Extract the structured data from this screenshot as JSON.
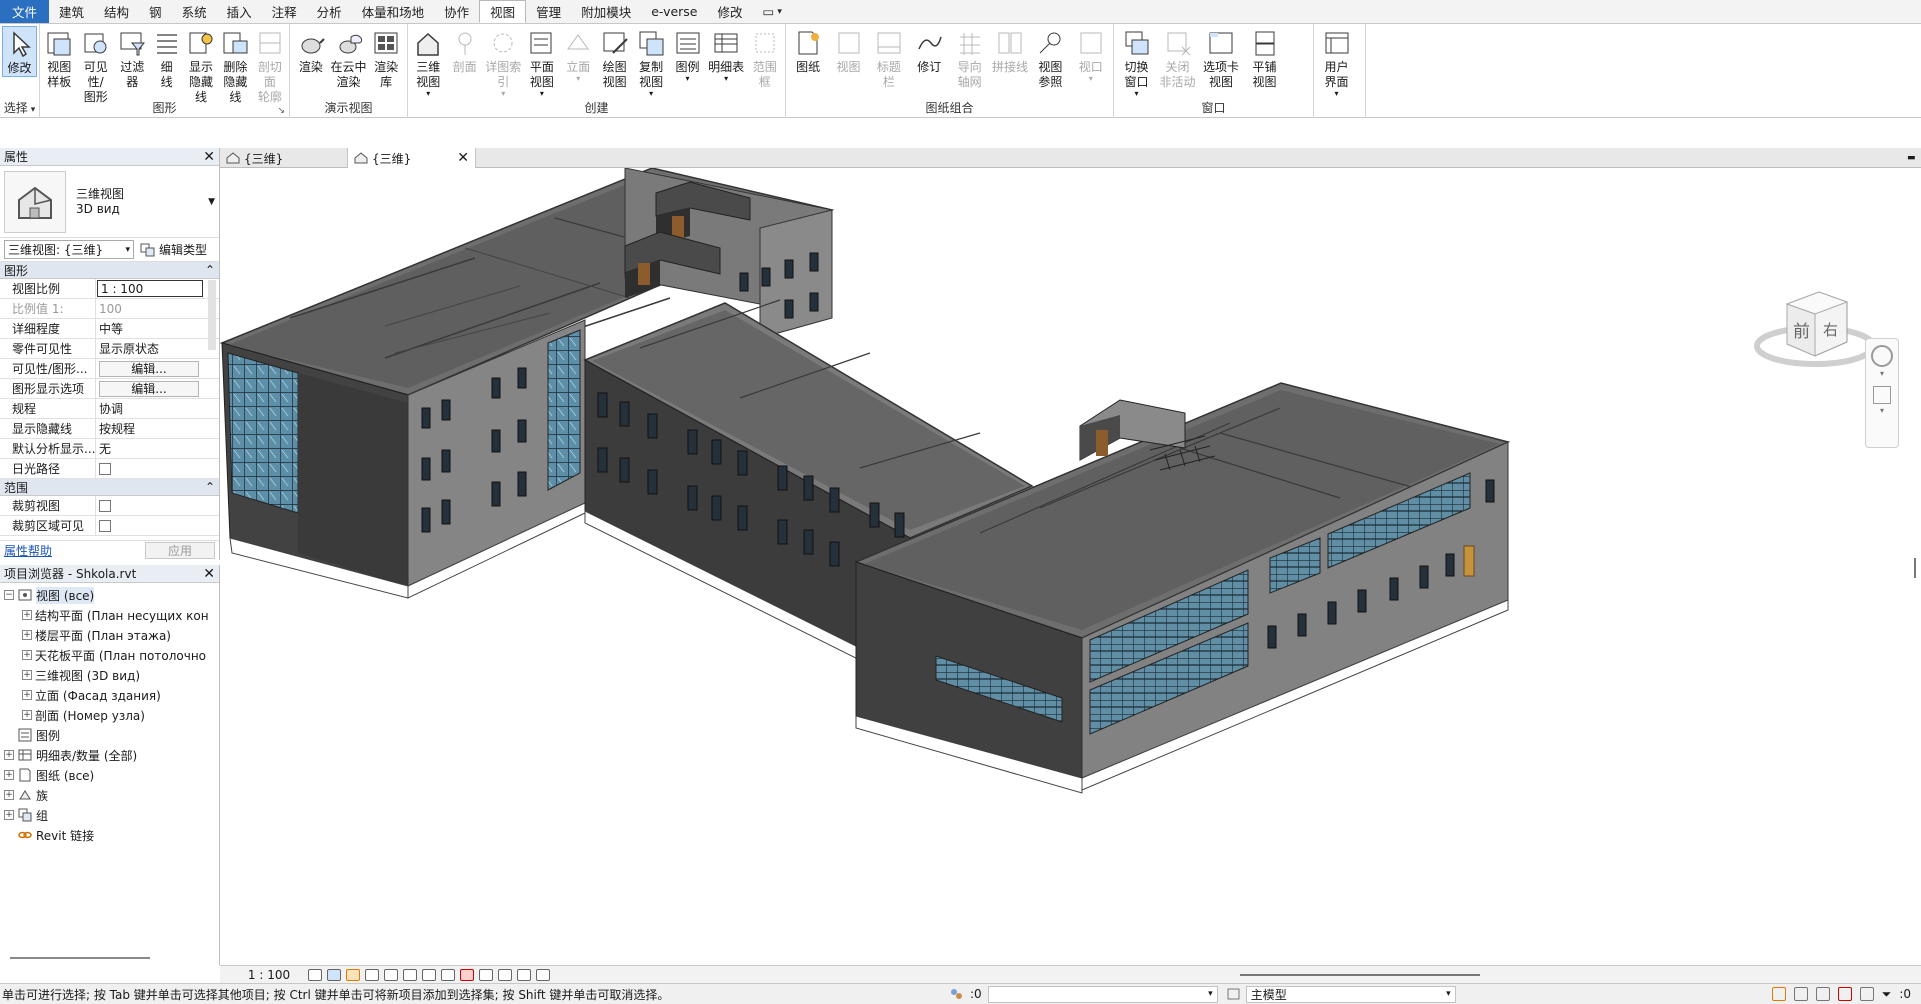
{
  "tabs": [
    {
      "label": "文件",
      "kind": "file"
    },
    {
      "label": "建筑"
    },
    {
      "label": "结构"
    },
    {
      "label": "钢"
    },
    {
      "label": "系统"
    },
    {
      "label": "插入"
    },
    {
      "label": "注释"
    },
    {
      "label": "分析"
    },
    {
      "label": "体量和场地"
    },
    {
      "label": "协作"
    },
    {
      "label": "视图",
      "active": true
    },
    {
      "label": "管理"
    },
    {
      "label": "附加模块"
    },
    {
      "label": "e-verse"
    },
    {
      "label": "修改"
    },
    {
      "label": "▭",
      "caret": "▾"
    }
  ],
  "panels": [
    {
      "title": "选择",
      "title_caret": "▾",
      "width": 40,
      "buttons": [
        {
          "label": "修改",
          "icon": "cursor-arrow-icon",
          "selected": true
        }
      ]
    },
    {
      "title": "图形",
      "dialog": "↘",
      "width": 250,
      "buttons": [
        {
          "label": "视图\n样板",
          "icon": "view-template-icon"
        },
        {
          "label": "可见性/\n图形",
          "icon": "visibility-graphics-icon",
          "wide": true
        },
        {
          "label": "过滤器",
          "icon": "filter-icon"
        },
        {
          "label": "细\n线",
          "icon": "thin-lines-icon"
        },
        {
          "label": "显示\n隐藏线",
          "icon": "show-hidden-lines-icon"
        },
        {
          "label": "删除\n隐藏线",
          "icon": "remove-hidden-lines-icon"
        },
        {
          "label": "剖切面\n轮廓",
          "icon": "cut-profile-icon",
          "disabled": true
        }
      ]
    },
    {
      "title": "演示视图",
      "width": 118,
      "buttons": [
        {
          "label": "渲染",
          "icon": "render-teapot-icon"
        },
        {
          "label": "在云中\n渲染",
          "icon": "render-cloud-icon"
        },
        {
          "label": "渲染\n库",
          "icon": "render-gallery-icon"
        }
      ]
    },
    {
      "title": "创建",
      "width": 378,
      "buttons": [
        {
          "label": "三维\n视图",
          "icon": "3d-house-icon",
          "caret": true
        },
        {
          "label": "剖面",
          "icon": "section-icon",
          "disabled": true
        },
        {
          "label": "详图索引",
          "icon": "callout-icon",
          "disabled": true,
          "caret": true,
          "wide": true
        },
        {
          "label": "平面\n视图",
          "icon": "plan-views-icon",
          "caret": true
        },
        {
          "label": "立面",
          "icon": "elevation-icon",
          "disabled": true,
          "caret": true
        },
        {
          "label": "绘图\n视图",
          "icon": "drafting-view-icon"
        },
        {
          "label": "复制\n视图",
          "icon": "duplicate-view-icon",
          "caret": true
        },
        {
          "label": "图例",
          "icon": "legend-icon",
          "caret": true
        },
        {
          "label": "明细表",
          "icon": "schedule-icon",
          "caret": true,
          "wide": true
        },
        {
          "label": "范围\n框",
          "icon": "scope-box-icon",
          "disabled": true
        }
      ]
    },
    {
      "title": "图纸组合",
      "width": 328,
      "buttons": [
        {
          "label": "图纸",
          "icon": "sheet-icon"
        },
        {
          "label": "视图",
          "icon": "place-view-icon",
          "disabled": true
        },
        {
          "label": "标题\n栏",
          "icon": "title-block-icon",
          "disabled": true
        },
        {
          "label": "修订",
          "icon": "revision-icon"
        },
        {
          "label": "导向\n轴网",
          "icon": "guide-grid-icon",
          "disabled": true
        },
        {
          "label": "拼接线",
          "icon": "matchline-icon",
          "disabled": true
        },
        {
          "label": "视图\n参照",
          "icon": "view-reference-icon"
        },
        {
          "label": "视口",
          "icon": "viewport-icon",
          "disabled": true,
          "caret": true
        }
      ]
    },
    {
      "title": "窗口",
      "width": 200,
      "buttons": [
        {
          "label": "切换\n窗口",
          "icon": "switch-windows-icon",
          "caret": true
        },
        {
          "label": "关闭\n非活动",
          "icon": "close-inactive-icon",
          "disabled": true
        },
        {
          "label": "选项卡\n视图",
          "icon": "tab-views-icon",
          "wide": true
        },
        {
          "label": "平铺\n视图",
          "icon": "tile-views-icon"
        }
      ]
    },
    {
      "title": "",
      "width": 52,
      "buttons": [
        {
          "label": "用户\n界面",
          "icon": "user-interface-icon",
          "caret": true
        }
      ]
    }
  ],
  "properties": {
    "title": "属性",
    "type_name": "三维视图",
    "type_sub": "3D вид",
    "instance_selector": "三维视图: {三维}",
    "edit_type": "编辑类型",
    "sections": [
      {
        "title": "图形",
        "rows": [
          {
            "k": "视图比例",
            "v": "1 : 100",
            "box": true
          },
          {
            "k": "比例值 1:",
            "v": "100",
            "disabled": true
          },
          {
            "k": "详细程度",
            "v": "中等"
          },
          {
            "k": "零件可见性",
            "v": "显示原状态"
          },
          {
            "k": "可见性/图形...",
            "v": "编辑...",
            "button": true
          },
          {
            "k": "图形显示选项",
            "v": "编辑...",
            "button": true
          },
          {
            "k": "规程",
            "v": "协调"
          },
          {
            "k": "显示隐藏线",
            "v": "按规程"
          },
          {
            "k": "默认分析显示...",
            "v": "无"
          },
          {
            "k": "日光路径",
            "v": "",
            "checkbox": true
          }
        ]
      },
      {
        "title": "范围",
        "rows": [
          {
            "k": "裁剪视图",
            "v": "",
            "checkbox": true
          },
          {
            "k": "裁剪区域可见",
            "v": "",
            "checkbox": true
          }
        ]
      }
    ],
    "help_link": "属性帮助",
    "apply_label": "应用"
  },
  "browser": {
    "title": "项目浏览器 - Shkola.rvt",
    "nodes": [
      {
        "level": 0,
        "exp": "⊟",
        "icon": "views-icon",
        "label": "视图 (все)",
        "selected": true
      },
      {
        "level": 1,
        "exp": "⊞",
        "icon": "",
        "label": "结构平面 (План несущих кон"
      },
      {
        "level": 1,
        "exp": "⊞",
        "icon": "",
        "label": "楼层平面 (План этажа)"
      },
      {
        "level": 1,
        "exp": "⊞",
        "icon": "",
        "label": "天花板平面 (План потолочно"
      },
      {
        "level": 1,
        "exp": "⊞",
        "icon": "",
        "label": "三维视图 (3D вид)"
      },
      {
        "level": 1,
        "exp": "⊞",
        "icon": "",
        "label": "立面 (Фасад здания)"
      },
      {
        "level": 1,
        "exp": "⊞",
        "icon": "",
        "label": "剖面 (Номер узла)"
      },
      {
        "level": 0,
        "exp": "",
        "icon": "legend-icon",
        "label": "图例"
      },
      {
        "level": 0,
        "exp": "⊞",
        "icon": "schedule-icon",
        "label": "明细表/数量 (全部)"
      },
      {
        "level": 0,
        "exp": "⊞",
        "icon": "sheet-icon",
        "label": "图纸 (все)"
      },
      {
        "level": 0,
        "exp": "⊞",
        "icon": "family-icon",
        "label": "族"
      },
      {
        "level": 0,
        "exp": "⊞",
        "icon": "group-icon",
        "label": "组"
      },
      {
        "level": 0,
        "exp": "",
        "icon": "revit-link-icon",
        "label": "Revit 链接"
      }
    ]
  },
  "view_tabs": [
    {
      "label": "{三维}",
      "active": false
    },
    {
      "label": "{三维}",
      "active": true
    }
  ],
  "viewcube": {
    "front": "前",
    "right": "右"
  },
  "view_control": {
    "scale": "1 : 100"
  },
  "status": {
    "message": "单击可进行选择; 按 Tab 键并单击可选择其他项目; 按 Ctrl 键并单击可将新项目添加到选择集; 按 Shift 键并单击可取消选择。",
    "count_left": ":0",
    "model": "主模型",
    "count_right": ":0"
  }
}
